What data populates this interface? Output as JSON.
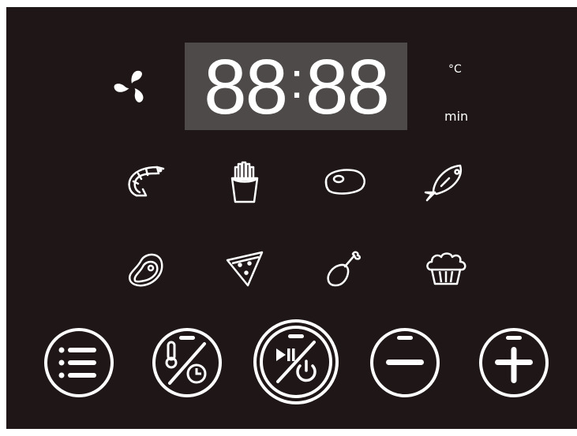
{
  "display": {
    "digits_left": "88",
    "colon": ":",
    "digits_right": "88"
  },
  "units": {
    "temperature": "°C",
    "time": "min"
  },
  "status_icons": [
    "fan-icon"
  ],
  "food_presets": [
    {
      "icon": "shrimp-icon"
    },
    {
      "icon": "fries-icon"
    },
    {
      "icon": "steak-icon"
    },
    {
      "icon": "fish-icon"
    },
    {
      "icon": "meat-chop-icon"
    },
    {
      "icon": "pizza-slice-icon"
    },
    {
      "icon": "chicken-leg-icon"
    },
    {
      "icon": "cake-icon"
    }
  ],
  "buttons": [
    {
      "icon": "menu-list-icon"
    },
    {
      "icon": "temperature-time-icon"
    },
    {
      "icon": "start-pause-power-icon"
    },
    {
      "icon": "minus-icon"
    },
    {
      "icon": "plus-icon"
    }
  ],
  "colors": {
    "panel": "#1f1717",
    "display": "#4d4a49",
    "foreground": "#ffffff"
  }
}
